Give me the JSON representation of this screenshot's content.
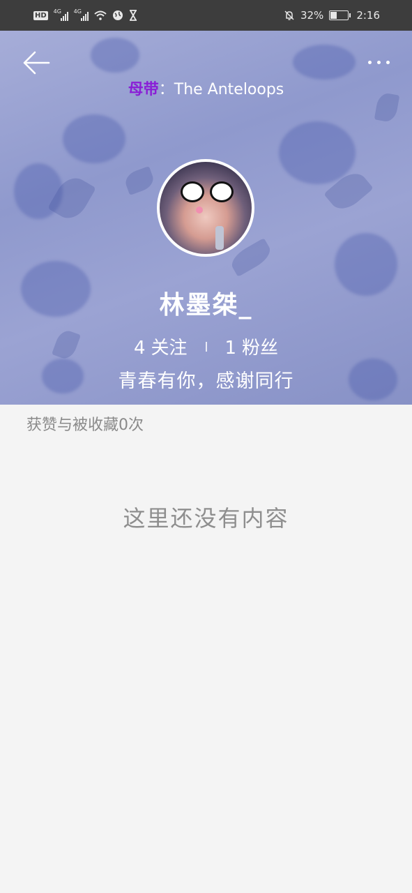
{
  "status_bar": {
    "hd_badge": "HD",
    "network_1": "4G",
    "network_2": "4G",
    "battery_percent": "32%",
    "battery_level": 0.32,
    "time": "2:16"
  },
  "profile": {
    "school_label": "母带",
    "school_separator": "：",
    "school_value": "The Anteloops",
    "username": "林墨桀_",
    "following_count": "4",
    "following_label": "关注",
    "followers_count": "1",
    "followers_label": "粉丝",
    "bio": "青春有你，感谢同行"
  },
  "content": {
    "likes_text": "获赞与被收藏0次",
    "empty_text": "这里还没有内容"
  }
}
